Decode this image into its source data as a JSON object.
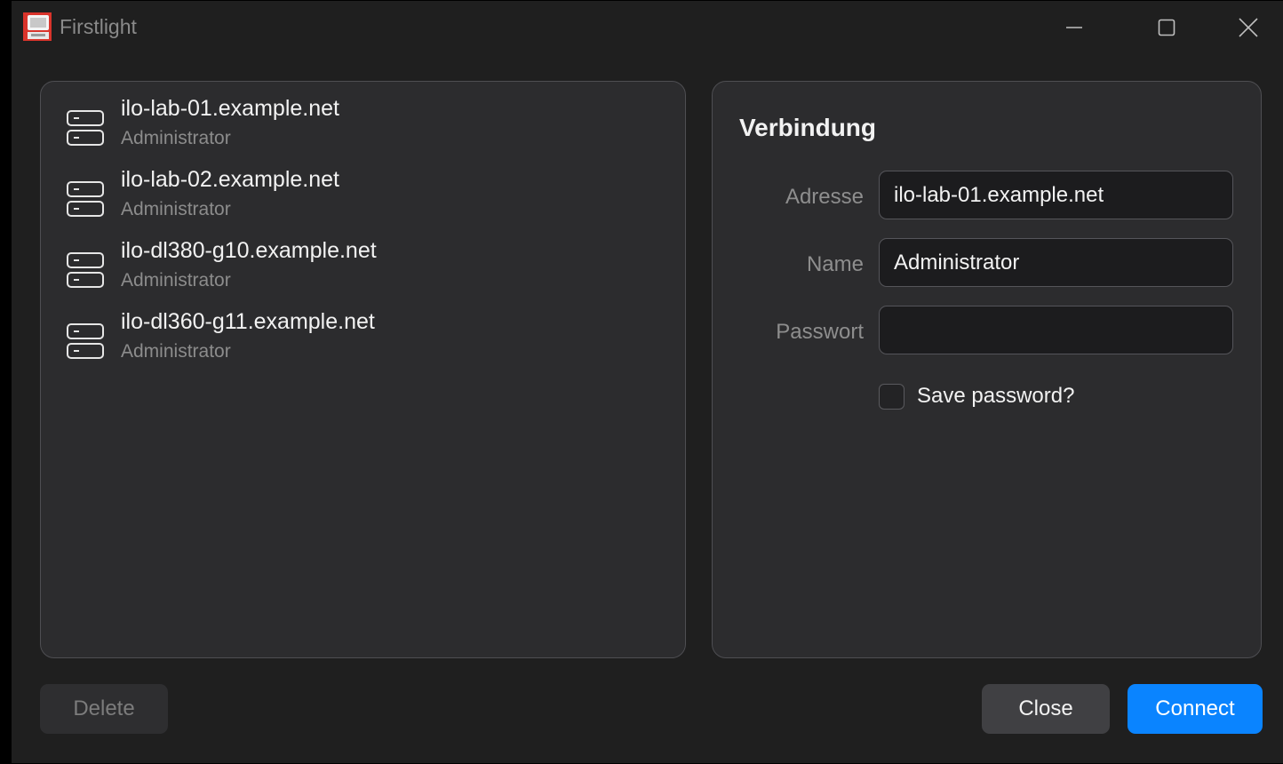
{
  "window": {
    "title": "Firstlight"
  },
  "connections": [
    {
      "host": "ilo-lab-01.example.net",
      "user": "Administrator"
    },
    {
      "host": "ilo-lab-02.example.net",
      "user": "Administrator"
    },
    {
      "host": "ilo-dl380-g10.example.net",
      "user": "Administrator"
    },
    {
      "host": "ilo-dl360-g11.example.net",
      "user": "Administrator"
    }
  ],
  "form": {
    "title": "Verbindung",
    "address_label": "Adresse",
    "address_value": "ilo-lab-01.example.net",
    "name_label": "Name",
    "name_value": "Administrator",
    "password_label": "Passwort",
    "password_value": "",
    "save_password_label": "Save password?",
    "save_password_checked": false
  },
  "buttons": {
    "delete": "Delete",
    "close": "Close",
    "connect": "Connect"
  },
  "icons": {
    "app": "firstlight-app-icon",
    "connection": "server-icon",
    "minimize": "minimize-icon",
    "maximize": "maximize-icon",
    "close": "close-icon"
  },
  "colors": {
    "accent": "#0a84ff",
    "app_icon_red": "#d9342b"
  }
}
